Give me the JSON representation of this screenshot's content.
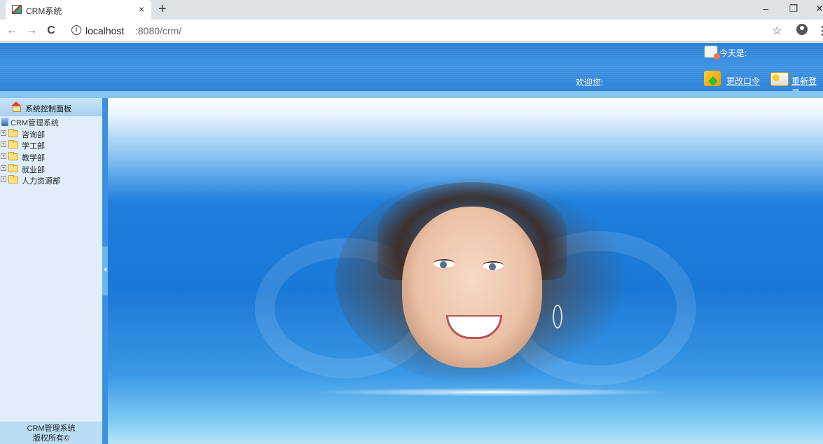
{
  "browser": {
    "tab_title": "CRM系统",
    "tab_close": "×",
    "new_tab": "+",
    "url_host": "localhost",
    "url_rest": ":8080/crm/",
    "back": "←",
    "forward": "→",
    "reload": "C",
    "info": "i",
    "star": "☆",
    "menu": "⋮",
    "minimize": "–",
    "restore": "❐",
    "close": "✕"
  },
  "header": {
    "today_label": "今天是:",
    "welcome_label": "欢迎您:",
    "change_password": "更改口令",
    "relogin": "重新登录"
  },
  "sidebar": {
    "panel_title": "系统控制面板",
    "tree_root": "CRM管理系统",
    "expander_symbol": "+",
    "items": [
      {
        "label": "咨询部"
      },
      {
        "label": "学工部"
      },
      {
        "label": "教学部"
      },
      {
        "label": "就业部"
      },
      {
        "label": "人力资源部"
      }
    ],
    "footer_line1": "CRM管理系统",
    "footer_line2": "版权所有©"
  },
  "colors": {
    "header_blue": "#2b7fd6",
    "sidebar_bg": "#dfeefa",
    "splitter": "#3c90de"
  }
}
